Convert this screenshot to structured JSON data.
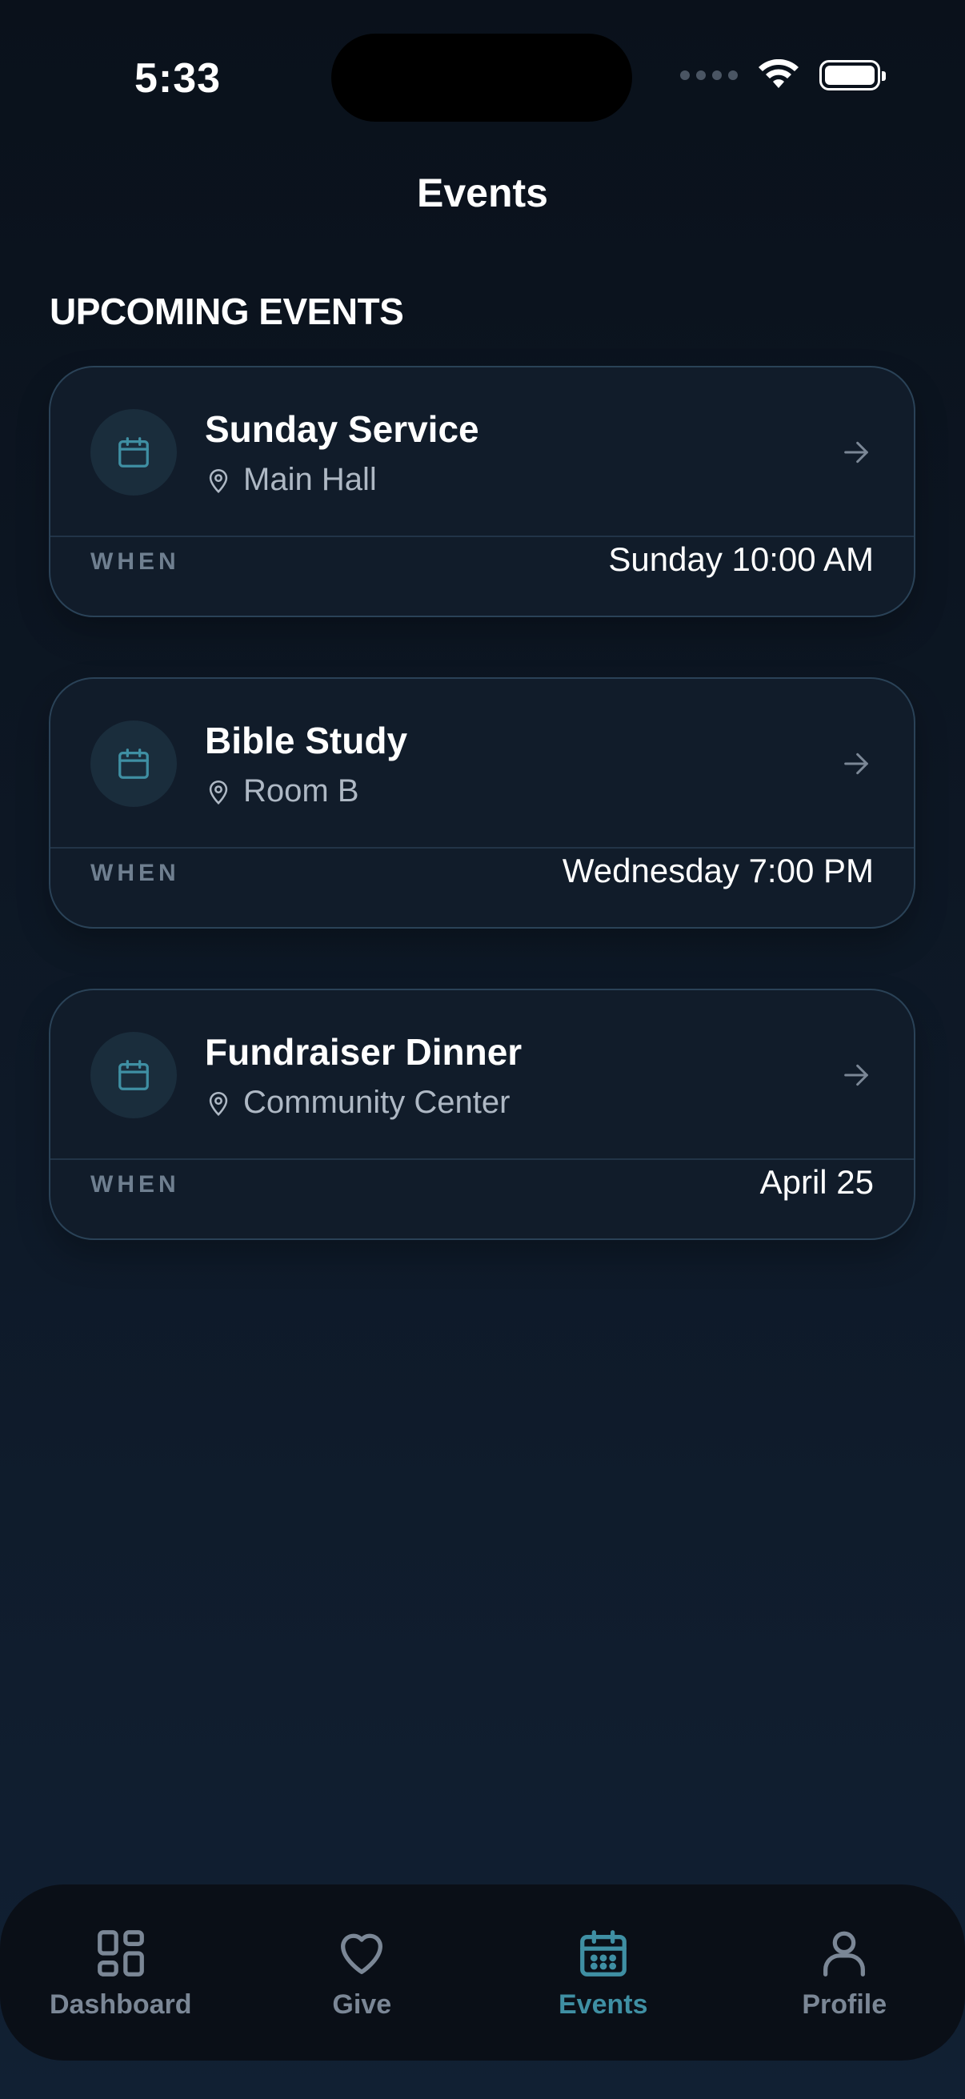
{
  "status_bar": {
    "time": "5:33"
  },
  "header": {
    "title": "Events"
  },
  "section": {
    "title": "UPCOMING EVENTS"
  },
  "events": [
    {
      "title": "Sunday Service",
      "location": "Main Hall",
      "when_label": "WHEN",
      "when": "Sunday 10:00 AM",
      "icon": "calendar-icon"
    },
    {
      "title": "Bible Study",
      "location": "Room B",
      "when_label": "WHEN",
      "when": "Wednesday 7:00 PM",
      "icon": "calendar-icon"
    },
    {
      "title": "Fundraiser Dinner",
      "location": "Community Center",
      "when_label": "WHEN",
      "when": "April 25",
      "icon": "calendar-icon"
    }
  ],
  "tabs": [
    {
      "label": "Dashboard",
      "icon": "grid-icon",
      "active": false
    },
    {
      "label": "Give",
      "icon": "heart-icon",
      "active": false
    },
    {
      "label": "Events",
      "icon": "calendar-icon",
      "active": true
    },
    {
      "label": "Profile",
      "icon": "person-icon",
      "active": false
    }
  ],
  "colors": {
    "accent": "#3f8fa3",
    "background": "#0d1724",
    "card": "#111c2a",
    "card_border": "#2a4257"
  }
}
